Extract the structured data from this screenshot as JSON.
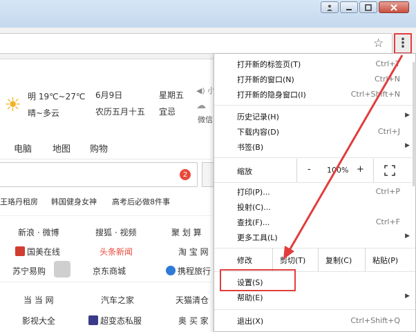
{
  "window": {
    "user_icon": "user-icon",
    "min_icon": "minimize-icon",
    "max_icon": "maximize-icon",
    "close_icon": "close-icon"
  },
  "toolbar": {
    "star_icon": "star-icon",
    "menu_icon": "more-vertical-icon"
  },
  "page": {
    "weather": {
      "line1": "明 19℃~27℃",
      "line2": "晴~多云",
      "date": "6月9日",
      "lunar": "农历五月十五",
      "weekday": "星期五",
      "yi": "宜忌",
      "speaker_text": "◀) 小",
      "wechat": "微信"
    },
    "nav": [
      "电脑",
      "地图",
      "购物"
    ],
    "search_badge": "2",
    "hot": [
      "王珞丹租房",
      "韩国健身女神",
      "高考后必做8件事"
    ],
    "sites": {
      "row1": [
        "新浪 · 微博",
        "搜狐 · 视频",
        "聚 划 算"
      ],
      "row2": [
        "国美在线",
        "头条新闻",
        "淘 宝 网"
      ],
      "row3": [
        "苏宁易购",
        "京东商城",
        "携程旅行"
      ],
      "row4": [
        "当 当 网",
        "汽车之家",
        "天猫清仓"
      ],
      "row5": [
        "影视大全",
        "超变态私服",
        "奥 买 家"
      ]
    }
  },
  "menu": {
    "items1": [
      {
        "label": "打开新的标签页(T)",
        "shortcut": "Ctrl+T"
      },
      {
        "label": "打开新的窗口(N)",
        "shortcut": "Ctrl+N"
      },
      {
        "label": "打开新的隐身窗口(I)",
        "shortcut": "Ctrl+Shift+N"
      }
    ],
    "items2": [
      {
        "label": "历史记录(H)",
        "shortcut": ""
      },
      {
        "label": "下载内容(D)",
        "shortcut": "Ctrl+J"
      },
      {
        "label": "书签(B)",
        "shortcut": ""
      }
    ],
    "zoom": {
      "label": "缩放",
      "minus": "-",
      "value": "100%",
      "plus": "+"
    },
    "items3": [
      {
        "label": "打印(P)...",
        "shortcut": "Ctrl+P"
      },
      {
        "label": "投射(C)...",
        "shortcut": ""
      },
      {
        "label": "查找(F)...",
        "shortcut": "Ctrl+F"
      },
      {
        "label": "更多工具(L)",
        "shortcut": ""
      }
    ],
    "edit": {
      "label": "修改",
      "cut": "剪切(T)",
      "copy": "复制(C)",
      "paste": "粘贴(P)"
    },
    "items4": [
      {
        "label": "设置(S)",
        "shortcut": ""
      },
      {
        "label": "帮助(E)",
        "shortcut": ""
      }
    ],
    "exit": {
      "label": "退出(X)",
      "shortcut": "Ctrl+Shift+Q"
    }
  },
  "colors": {
    "highlight": "#e23c3c",
    "accent_red": "#e84a3c"
  }
}
